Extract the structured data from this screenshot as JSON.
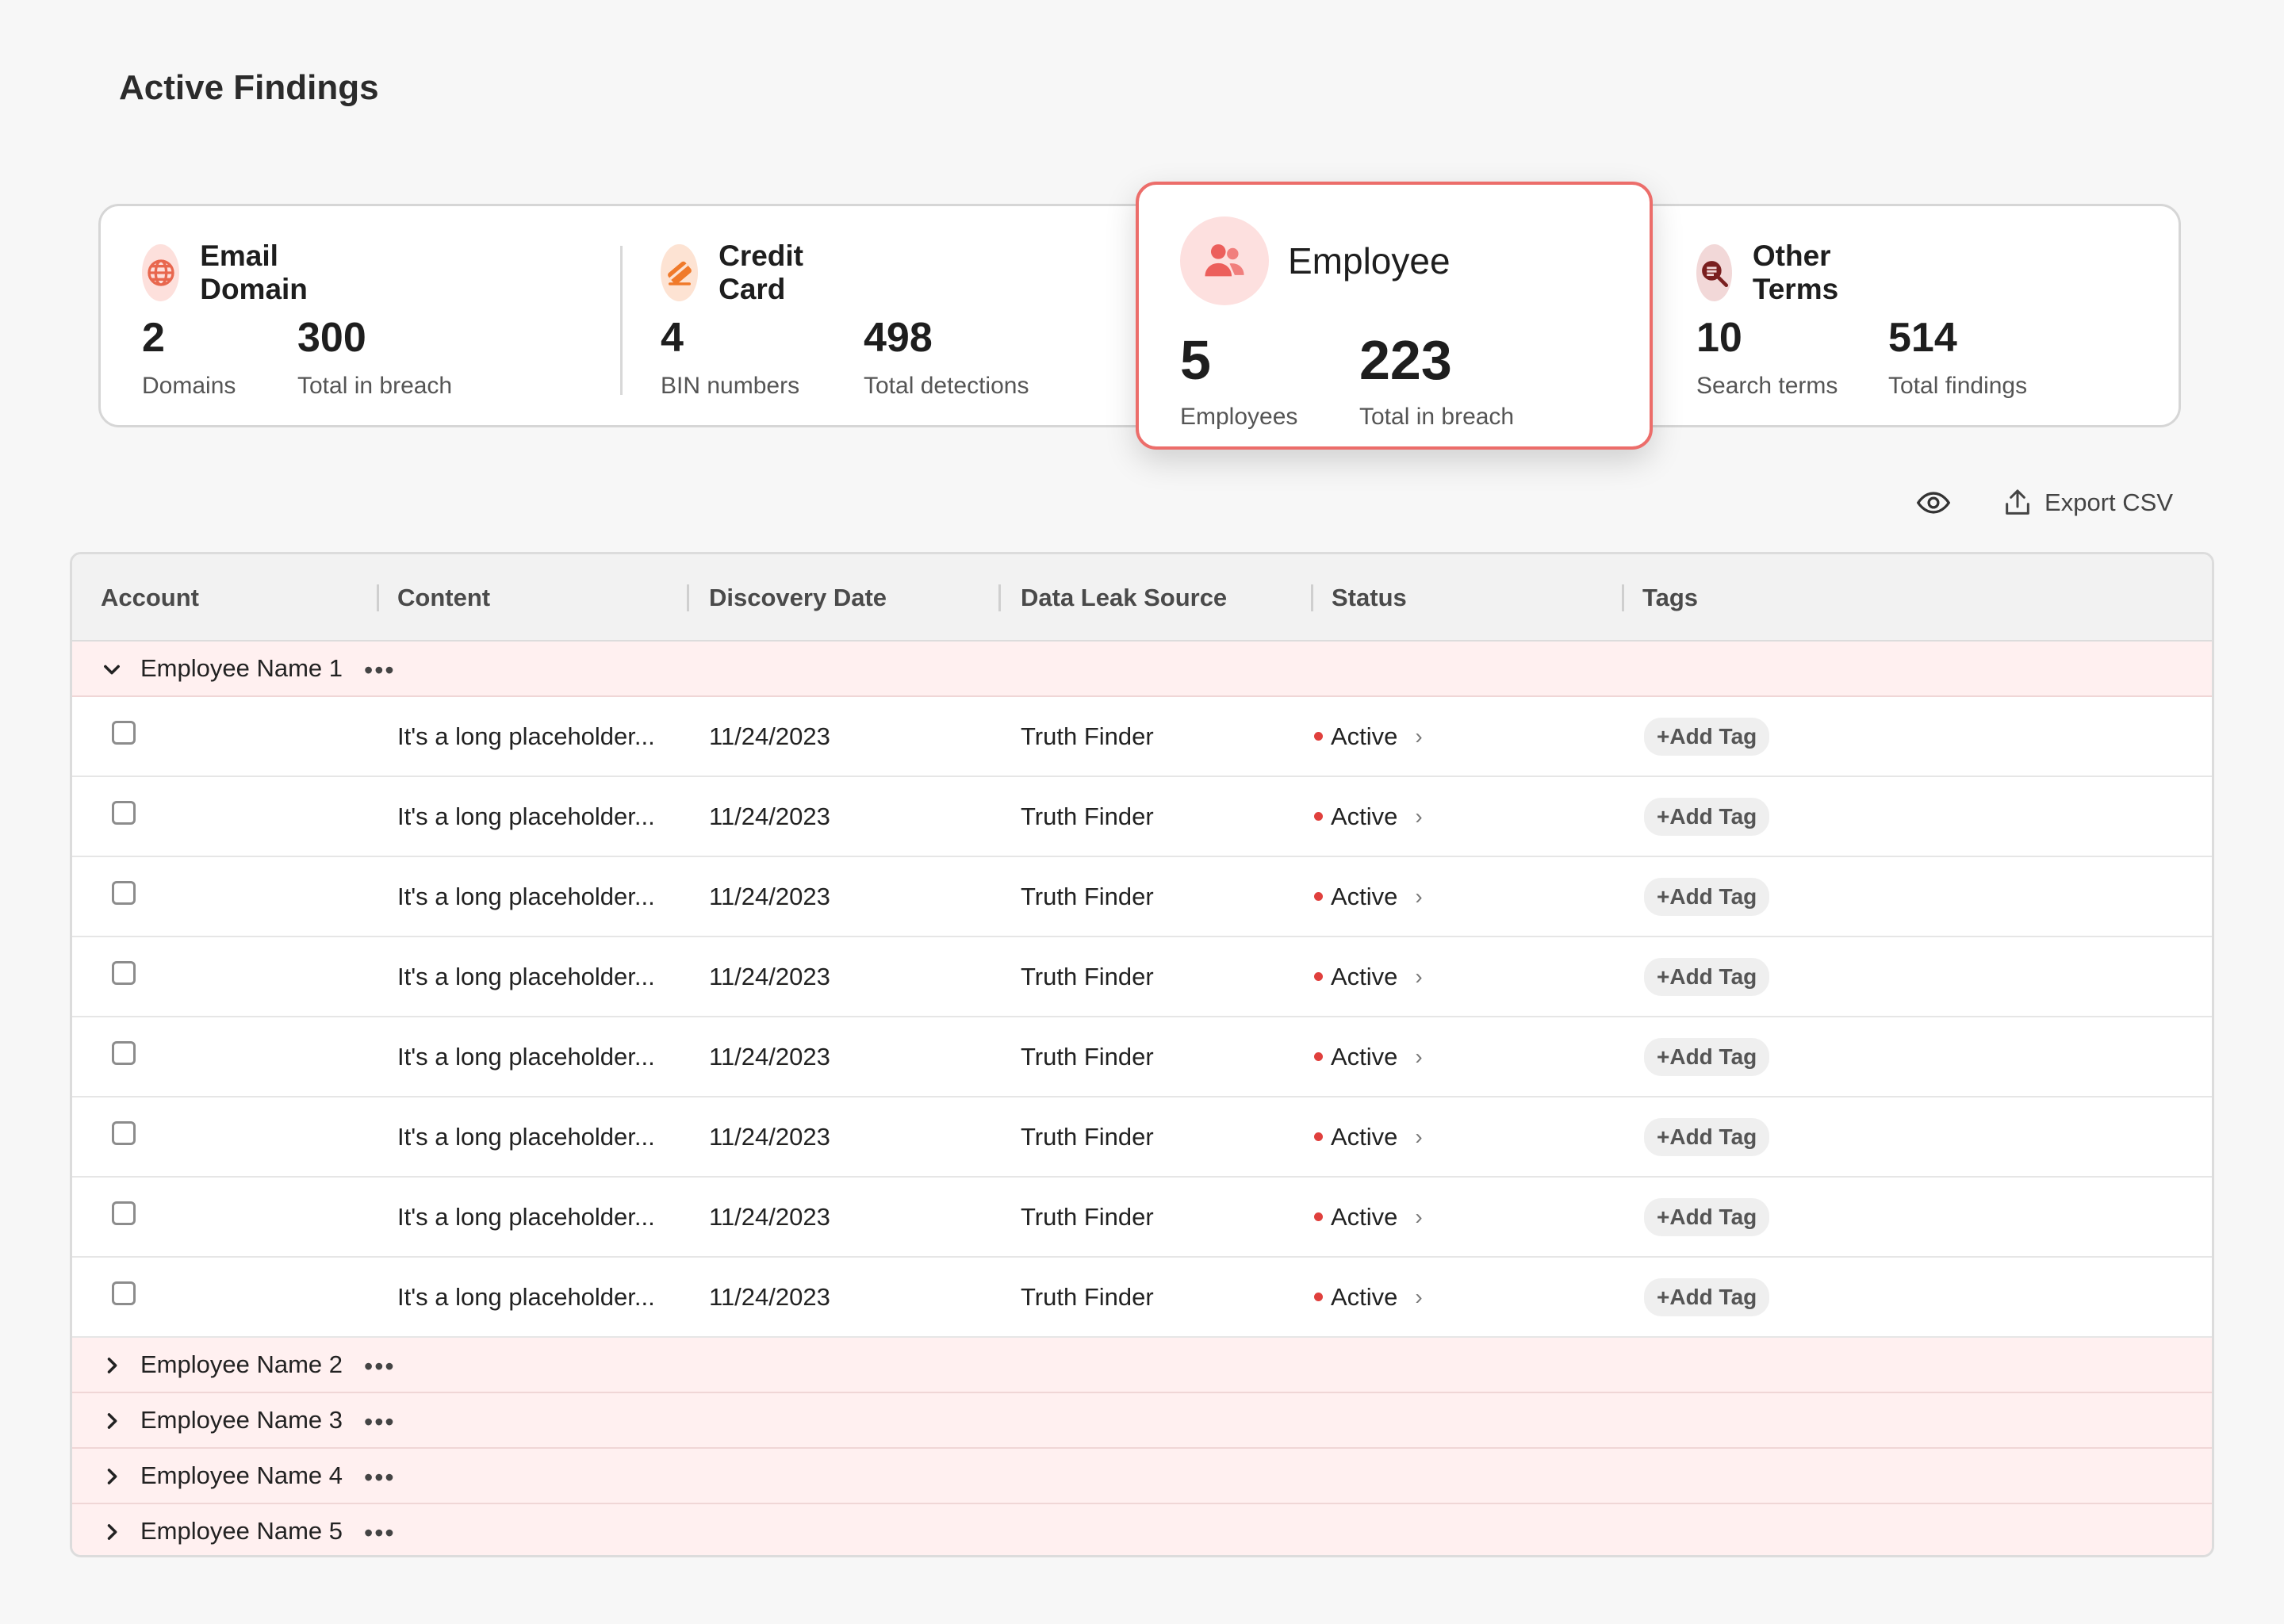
{
  "page_title": "Active Findings",
  "summary": {
    "cards": [
      {
        "label": "Email Domain",
        "icon": "globe-icon",
        "stats": [
          {
            "value": "2",
            "caption": "Domains"
          },
          {
            "value": "300",
            "caption": "Total in breach"
          }
        ]
      },
      {
        "label": "Credit Card",
        "icon": "credit-card-icon",
        "stats": [
          {
            "value": "4",
            "caption": "BIN numbers"
          },
          {
            "value": "498",
            "caption": "Total detections"
          }
        ]
      },
      {
        "label": "Employee",
        "icon": "users-icon",
        "stats": [
          {
            "value": "5",
            "caption": "Employees"
          },
          {
            "value": "223",
            "caption": "Total in breach"
          }
        ]
      },
      {
        "label": "Other Terms",
        "icon": "search-terms-icon",
        "stats": [
          {
            "value": "10",
            "caption": "Search terms"
          },
          {
            "value": "514",
            "caption": "Total findings"
          }
        ]
      }
    ]
  },
  "toolbar": {
    "eye_icon": "eye-icon",
    "export_label": "Export CSV"
  },
  "table": {
    "columns": [
      "Account",
      "Content",
      "Discovery Date",
      "Data Leak Source",
      "Status",
      "Tags"
    ],
    "expanded_group": {
      "name": "Employee Name 1",
      "rows": [
        {
          "content": "It's a long placeholder...",
          "date": "11/24/2023",
          "source": "Truth Finder",
          "status": "Active",
          "tag": "+Add Tag"
        },
        {
          "content": "It's a long placeholder...",
          "date": "11/24/2023",
          "source": "Truth Finder",
          "status": "Active",
          "tag": "+Add Tag"
        },
        {
          "content": "It's a long placeholder...",
          "date": "11/24/2023",
          "source": "Truth Finder",
          "status": "Active",
          "tag": "+Add Tag"
        },
        {
          "content": "It's a long placeholder...",
          "date": "11/24/2023",
          "source": "Truth Finder",
          "status": "Active",
          "tag": "+Add Tag"
        },
        {
          "content": "It's a long placeholder...",
          "date": "11/24/2023",
          "source": "Truth Finder",
          "status": "Active",
          "tag": "+Add Tag"
        },
        {
          "content": "It's a long placeholder...",
          "date": "11/24/2023",
          "source": "Truth Finder",
          "status": "Active",
          "tag": "+Add Tag"
        },
        {
          "content": "It's a long placeholder...",
          "date": "11/24/2023",
          "source": "Truth Finder",
          "status": "Active",
          "tag": "+Add Tag"
        },
        {
          "content": "It's a long placeholder...",
          "date": "11/24/2023",
          "source": "Truth Finder",
          "status": "Active",
          "tag": "+Add Tag"
        }
      ]
    },
    "collapsed_groups": [
      "Employee Name 2",
      "Employee Name 3",
      "Employee Name 4",
      "Employee Name 5"
    ],
    "more_glyph": "•••"
  },
  "colors": {
    "accent": "#ec6d6a",
    "status_active": "#e0403d",
    "group_bg": "#fff0f0"
  }
}
